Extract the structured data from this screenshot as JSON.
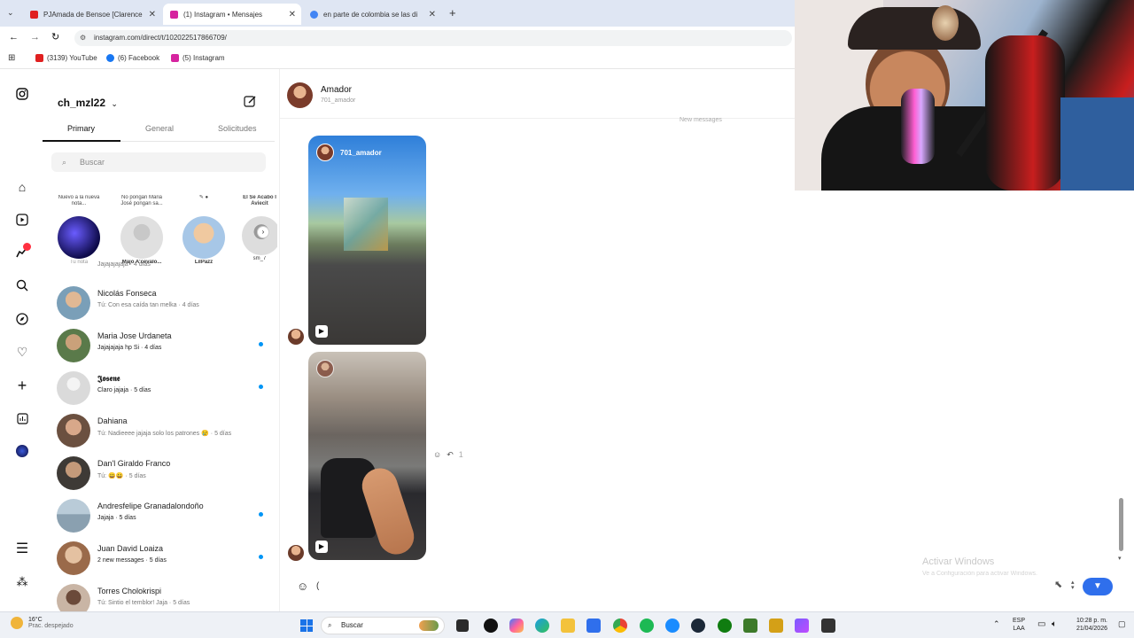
{
  "browser": {
    "tabs": [
      {
        "title": "PJAmada de Bensoe [Clarence",
        "active": false,
        "favicon_color": "#e02020"
      },
      {
        "title": "(1) Instagram • Mensajes",
        "active": true,
        "favicon_color": "#d6249f"
      },
      {
        "title": "en parte de colombia se las di",
        "active": false,
        "favicon_color": "#4285f4"
      }
    ],
    "url": "instagram.com/direct/t/102022517866709/",
    "bookmarks": [
      {
        "label": "(3139) YouTube",
        "color": "#e02020"
      },
      {
        "label": "(6) Facebook",
        "color": "#1877f2"
      },
      {
        "label": "(5) Instagram",
        "color": "#d6249f"
      }
    ]
  },
  "sidebar": {
    "username": "ch_mzl22",
    "tabs": [
      "Primary",
      "General",
      "Solicitudes"
    ],
    "search_placeholder": "Buscar",
    "stories": [
      {
        "note": "Nuevo a la nueva nota...",
        "name": "Tu nota"
      },
      {
        "note": "No pongan Maria José pongan sa...",
        "name": "Majo A'cevalo..."
      },
      {
        "note": "✎ ●",
        "name": "LilPazz"
      },
      {
        "note": "El Se Acabo I Aviecit",
        "name": "sm_7"
      }
    ],
    "clipped_preview": "Jajajajajaja · 4 días",
    "conversations": [
      {
        "name": "Nicolás Fonseca",
        "preview": "Tú: Con esa caída tan melka · 4 días",
        "unread": false,
        "color": "#7a9fb8"
      },
      {
        "name": "Maria Jose Urdaneta",
        "preview": "Jajajajaja hp Si · 4 días",
        "unread": true,
        "color": "#5a7a4a"
      },
      {
        "name": "𝕵𝖔𝖘𝖊𝖓𝖊",
        "preview": "Claro jajaja · 5 días",
        "unread": true,
        "color": "#d6d6d6"
      },
      {
        "name": "Dahiana",
        "preview": "Tú: Nadieeee jajaja solo los patrones 😢 · 5 días",
        "unread": false,
        "color": "#6b5040"
      },
      {
        "name": "Dan'l Giraldo Franco",
        "preview": "Tú: 😀😀 · 5 días",
        "unread": false,
        "color": "#3e3a36"
      },
      {
        "name": "Andresfelipe Granadalondoño",
        "preview": "Jajaja · 5 días",
        "unread": true,
        "color": "#8aa0b0"
      },
      {
        "name": "Juan David Loaiza",
        "preview": "2 new messages · 5 días",
        "unread": true,
        "color": "#9a6a4a"
      },
      {
        "name": "Torres Cholokrispi",
        "preview": "Tú: Sintio el temblor! Jaja · 5 días",
        "unread": false,
        "color": "#c9b5a5"
      }
    ]
  },
  "chat": {
    "contact_name": "Amador",
    "contact_handle": "701_amador",
    "divider": "New messages",
    "reel_author": "701_amador",
    "message_placeholder": "(",
    "react_count": "1"
  },
  "windows_watermark": {
    "title": "Activar Windows",
    "subtitle": "Ve a Configuración para activar Windows."
  },
  "taskbar": {
    "weather_temp": "16°C",
    "weather_desc": "Prac. despejado",
    "search_label": "Buscar",
    "lang_top": "ESP",
    "lang_bottom": "LAA",
    "time": "10:28 p. m.",
    "date": "21/04/2026"
  }
}
